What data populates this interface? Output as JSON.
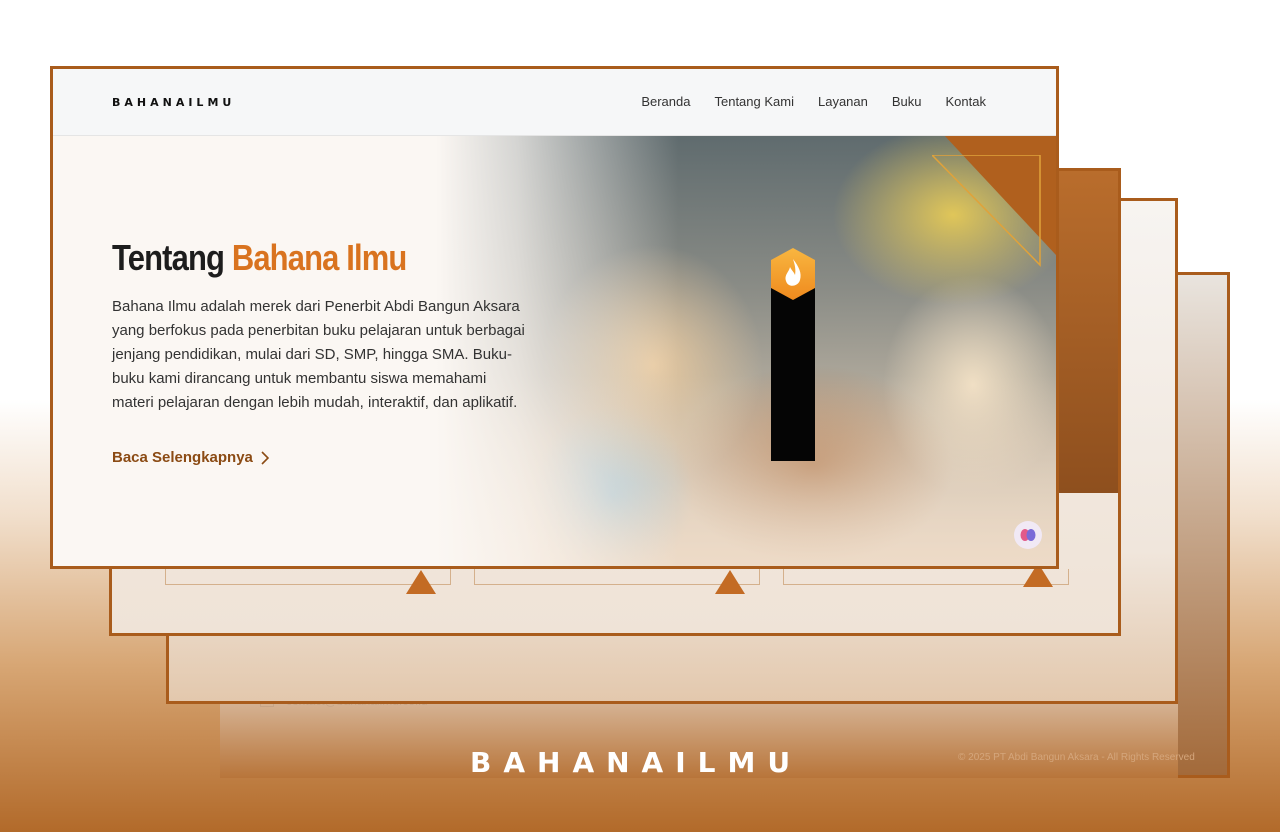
{
  "nav": {
    "logo": "BAHANAILMU",
    "links": [
      "Beranda",
      "Tentang Kami",
      "Layanan",
      "Buku",
      "Kontak"
    ]
  },
  "hero": {
    "title_prefix": "Tentang ",
    "title_accent": "Bahana Ilmu",
    "description": "Bahana Ilmu adalah merek dari Penerbit Abdi Bangun Aksara yang berfokus pada penerbitan buku pelajaran untuk berbagai jenjang pendidikan, mulai dari SD, SMP, hingga SMA. Buku-buku kami dirancang untuk membantu siswa memahami materi pelajaran dengan lebih mudah, interaktif, dan aplikatif.",
    "cta_label": "Baca Selengkapnya"
  },
  "footer": {
    "email": "contact@bahanailmu.co.id",
    "copyright": "© 2025 PT Abdi Bangun Aksara - All Rights Reserved"
  },
  "branding": {
    "big_logo": "BAHANAILMU",
    "accent_color": "#d9731f",
    "brand_brown": "#a95c1c"
  },
  "icons": [
    "chevron-right-icon",
    "flame-icon",
    "brain-icon",
    "mail-icon"
  ]
}
